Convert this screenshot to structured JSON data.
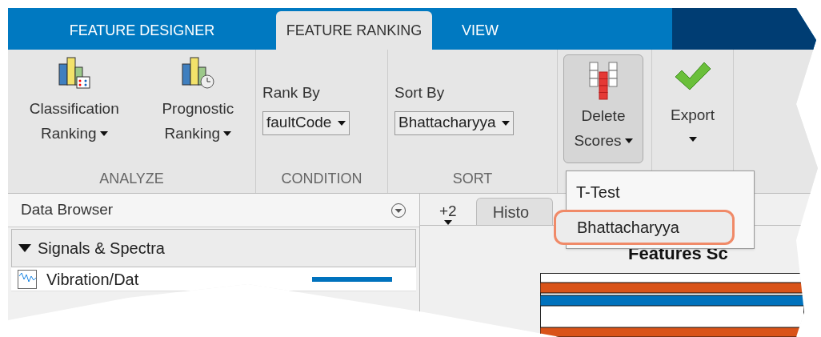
{
  "tabs": [
    {
      "label": "FEATURE DESIGNER",
      "selected": false
    },
    {
      "label": "FEATURE RANKING",
      "selected": true
    },
    {
      "label": "VIEW",
      "selected": false
    }
  ],
  "ribbon": {
    "analyze": {
      "label": "ANALYZE",
      "buttons": [
        {
          "kind": "classification",
          "line1": "Classification",
          "line2": "Ranking"
        },
        {
          "kind": "prognostic",
          "line1": "Prognostic",
          "line2": "Ranking"
        }
      ]
    },
    "condition": {
      "label": "CONDITION",
      "field_label": "Rank By",
      "value": "faultCode"
    },
    "sort": {
      "label": "SORT",
      "field_label": "Sort By",
      "value": "Bhattacharyya"
    },
    "delete_scores": {
      "line1": "Delete",
      "line2": "Scores",
      "pressed": true
    },
    "export": {
      "label": "Export"
    }
  },
  "menu": {
    "items": [
      {
        "label": "T-Test",
        "selected": false
      },
      {
        "label": "Bhattacharyya",
        "selected": true
      }
    ]
  },
  "data_browser": {
    "title": "Data Browser",
    "section": {
      "label": "Signals & Spectra",
      "expanded": true
    },
    "rows": [
      {
        "label": "Vibration/Dat",
        "color": "#0072bd"
      }
    ]
  },
  "document_tabs": {
    "overflow": "+2",
    "tabs": [
      {
        "label": "Histo"
      }
    ]
  },
  "chart": {
    "title": "Features Sc"
  }
}
